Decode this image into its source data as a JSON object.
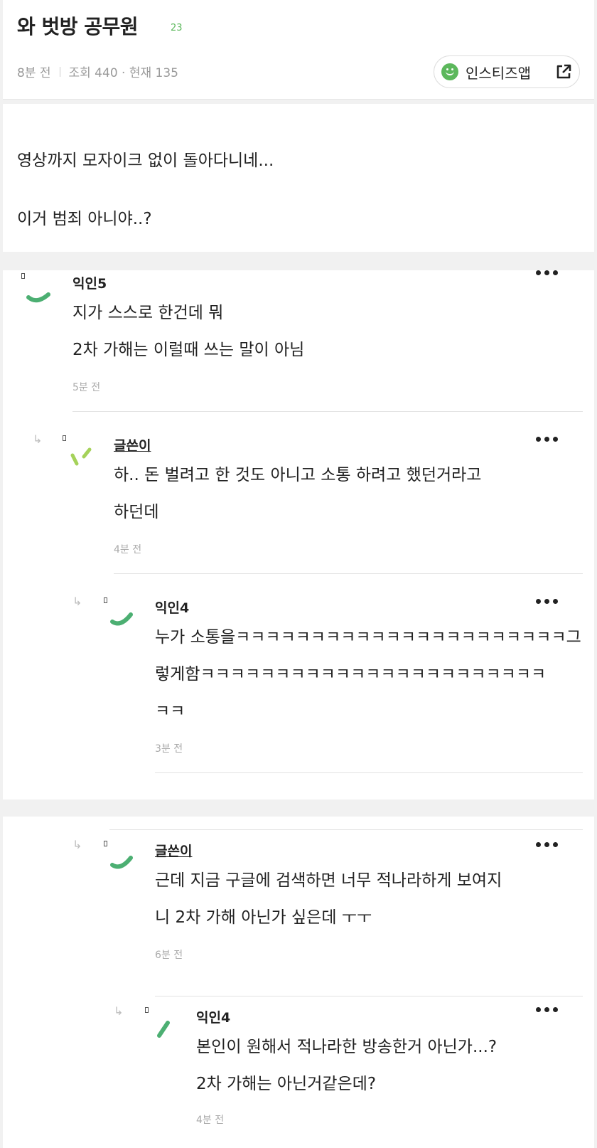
{
  "post": {
    "title": "와 벗방 공무원",
    "comment_count": "23",
    "time": "8분 전",
    "views": "조회 440 · 현재 135",
    "app_button": "인스티즈앱",
    "body_lines": [
      "영상까지 모자이크 없이 돌아다니네...",
      "이거 범죄 아니야..?"
    ]
  },
  "comments": [
    {
      "author": "익인5",
      "lines": [
        "지가 스스로 한건데 뭐",
        "2차 가해는 이럴때 쓰는 말이 아님"
      ],
      "time": "5분 전",
      "avatar_color": "#4caf72"
    },
    {
      "author": "글쓴이",
      "lines": [
        "하.. 돈 벌려고 한 것도 아니고 소통 하려고 했던거라고",
        "하던데"
      ],
      "time": "4분 전",
      "avatar_color": "#a5d25a"
    },
    {
      "author": "익인4",
      "lines": [
        "누가 소통을ㅋㅋㅋㅋㅋㅋㅋㅋㅋㅋㅋㅋㅋㅋㅋㅋㅋㅋㅋㅋㅋㅋ그",
        "렇게함ㅋㅋㅋㅋㅋㅋㅋㅋㅋㅋㅋㅋㅋㅋㅋㅋㅋㅋㅋㅋㅋㅋㅋ",
        "ㅋㅋ"
      ],
      "time": "3분 전",
      "avatar_color": "#4caf72"
    },
    {
      "author": "글쓴이",
      "lines": [
        "근데 지금 구글에 검색하면 너무 적나라하게 보여지",
        "니 2차 가해 아닌가 싶은데 ㅜㅜ"
      ],
      "time": "6분 전",
      "avatar_color": "#4caf72"
    },
    {
      "author": "익인4",
      "lines": [
        "본인이 원해서 적나라한 방송한거 아닌가...?",
        "2차 가해는 아닌거같은데?"
      ],
      "time": "4분 전",
      "avatar_color": "#4caf72"
    }
  ],
  "icons": {
    "reply": "reply-arrow-icon",
    "more": "more-dots-icon",
    "external": "external-link-icon",
    "smile": "smile-icon"
  },
  "colors": {
    "accent": "#5cb85c"
  }
}
